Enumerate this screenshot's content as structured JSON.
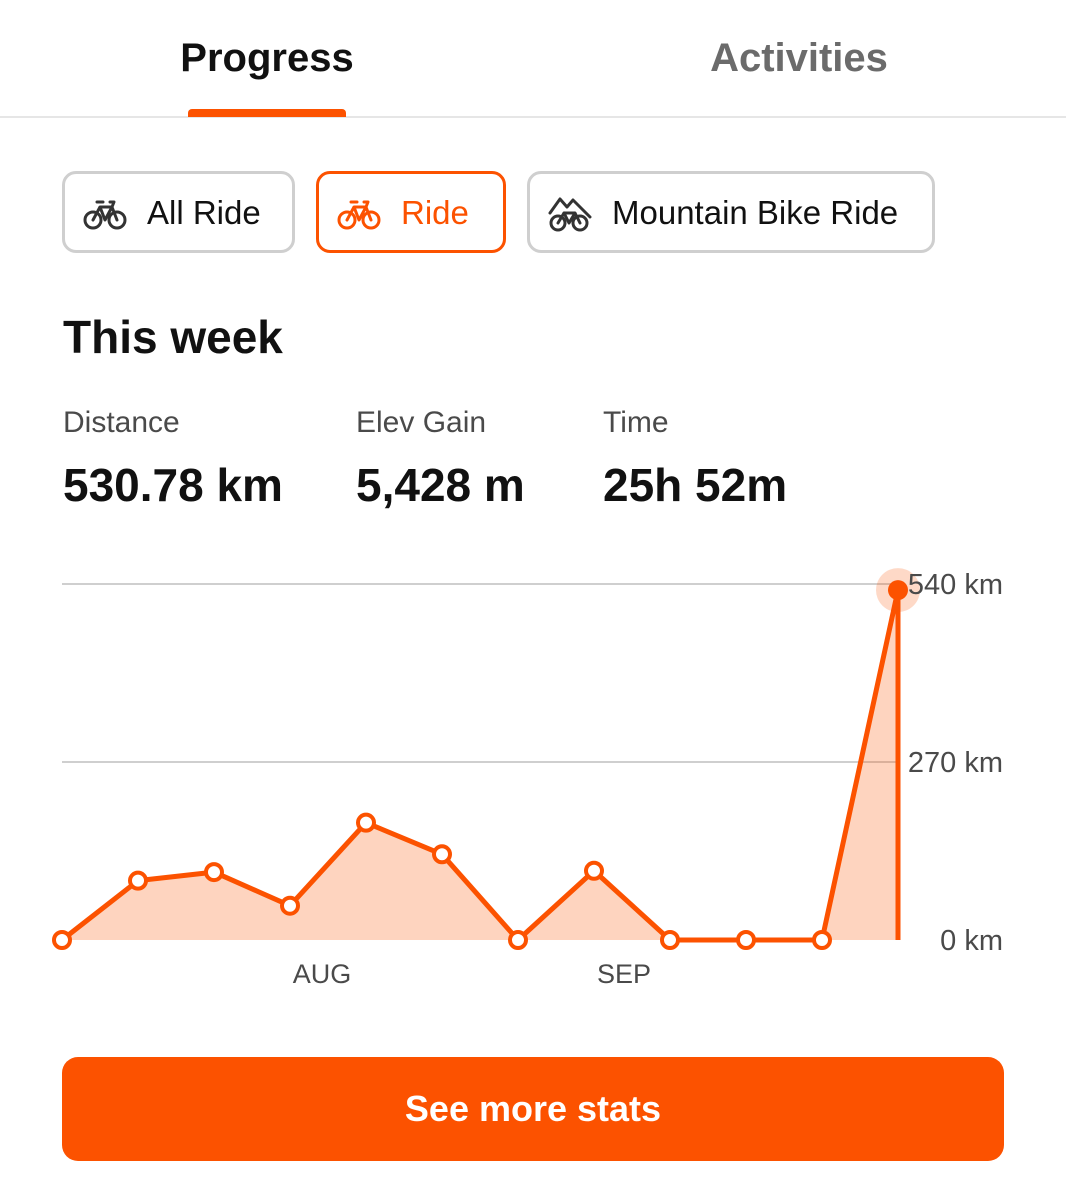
{
  "tabs": [
    {
      "label": "Progress",
      "active": true
    },
    {
      "label": "Activities",
      "active": false
    }
  ],
  "filters": [
    {
      "label": "All Ride",
      "icon": "bike-icon",
      "selected": false
    },
    {
      "label": "Ride",
      "icon": "bike-icon",
      "selected": true
    },
    {
      "label": "Mountain Bike Ride",
      "icon": "mountain-bike-icon",
      "selected": false
    }
  ],
  "section_title": "This week",
  "stats": [
    {
      "label": "Distance",
      "value": "530.78 km"
    },
    {
      "label": "Elev Gain",
      "value": "5,428 m"
    },
    {
      "label": "Time",
      "value": "25h 52m"
    }
  ],
  "accent_color": "#fc5200",
  "chart_data": {
    "type": "area",
    "x_labels": [
      "AUG",
      "SEP"
    ],
    "y_tick_labels": [
      "540 km",
      "270 km",
      "0 km"
    ],
    "ylim": [
      0,
      540
    ],
    "grid": true,
    "values": [
      0,
      90,
      103,
      52,
      178,
      130,
      0,
      105,
      0,
      0,
      0,
      530.78
    ],
    "highlight_index": 11
  },
  "cta_label": "See more stats"
}
